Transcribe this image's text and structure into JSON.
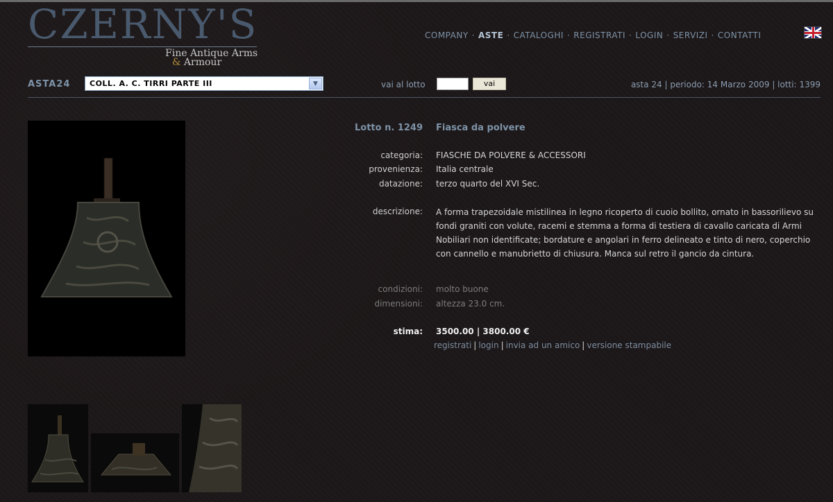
{
  "logo": {
    "name": "CZERNY'S",
    "tagline_1": "Fine Antique Arms",
    "tagline_amp": "&",
    "tagline_2": "Armour"
  },
  "nav": {
    "items": [
      {
        "label": "COMPANY",
        "active": false
      },
      {
        "label": "ASTE",
        "active": true
      },
      {
        "label": "CATALOGHI",
        "active": false
      },
      {
        "label": "REGISTRATI",
        "active": false
      },
      {
        "label": "LOGIN",
        "active": false
      },
      {
        "label": "SERVIZI",
        "active": false
      },
      {
        "label": "CONTATTI",
        "active": false
      }
    ],
    "separator": "·",
    "language_icon": "uk-flag-icon"
  },
  "toolbar": {
    "asta_label": "ASTA24",
    "catalog_select_value": "COLL. A. C. TIRRI PARTE III",
    "goto_label": "vai al lotto",
    "goto_value": "",
    "goto_button": "vai",
    "asta_info": "asta 24 | periodo: 14 Marzo 2009 | lotti: 1399"
  },
  "lot": {
    "number_label": "Lotto n. 1249",
    "title": "Fiasca da polvere",
    "fields": {
      "categoria_label": "categoria:",
      "categoria": "FIASCHE DA POLVERE & ACCESSORI",
      "provenienza_label": "provenienza:",
      "provenienza": "Italia centrale",
      "datazione_label": "datazione:",
      "datazione": "terzo quarto del XVI Sec.",
      "descrizione_label": "descrizione:",
      "descrizione": "A forma trapezoidale mistilinea in legno ricoperto di cuoio bollito, ornato in bassorilievo su fondi graniti con volute, racemi e stemma a forma di testiera di cavallo caricata di Armi Nobiliari non identificate; bordature e angolari in ferro delineato e tinto di nero, coperchio con cannello e manubrietto di chiusura. Manca sul retro il gancio da cintura.",
      "condizioni_label": "condizioni:",
      "condizioni": "molto buone",
      "dimensioni_label": "dimensioni:",
      "dimensioni": "altezza 23.0 cm.",
      "stima_label": "stima:",
      "stima": "3500.00 | 3800.00 €"
    },
    "actions": {
      "registrati": "registrati",
      "login": "login",
      "invia": "invia ad un amico",
      "stampa": "versione stampabile"
    }
  },
  "colors": {
    "background": "#1c1718",
    "accent": "#7d93a8",
    "logo": "#4a5a6e"
  }
}
